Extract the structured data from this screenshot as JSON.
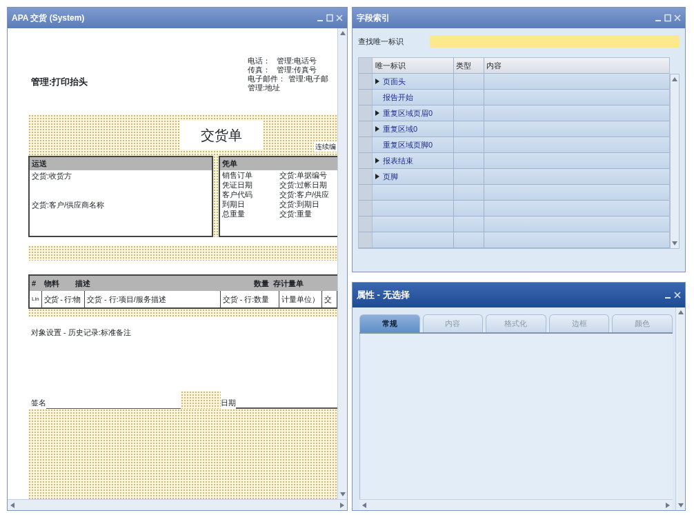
{
  "report_window": {
    "title": "APA 交货 (System)",
    "print_heading": "管理:打印抬头",
    "contacts": [
      {
        "label": "电话：",
        "value": "管理:电话号"
      },
      {
        "label": "传真：",
        "value": "管理:传真号"
      },
      {
        "label": "电子邮件：",
        "value": "管理:电子邮"
      }
    ],
    "address": "管理:地址",
    "document_title": "交货单",
    "doc_note": "连续编",
    "ship_box": {
      "heading": "运送",
      "lines": [
        "交货:收货方",
        "交货:客户/供应商名称"
      ]
    },
    "info_box": {
      "heading": "凭单",
      "rows": [
        {
          "label": "销售订单",
          "value": "交货:单据编号"
        },
        {
          "label": "凭证日期",
          "value": "交货:过帐日期"
        },
        {
          "label": "客户代码",
          "value": "交货:客户/供应"
        },
        {
          "label": "到期日",
          "value": "交货:到期日"
        },
        {
          "label": "总重量",
          "value": "交货:重量"
        }
      ]
    },
    "items_table": {
      "columns": [
        "#",
        "物料",
        "描述",
        "数量",
        "存计量单"
      ],
      "row": [
        "Lin",
        "交货 - 行:物",
        "交货 - 行:项目/服务描述",
        "交货 - 行:数量",
        "计量单位）",
        "交"
      ]
    },
    "remarks": "对象设置 - 历史记录:标准备注",
    "signature_label": "签名",
    "date_label": "日期"
  },
  "field_index": {
    "title": "字段索引",
    "search_label": "查找唯一标识",
    "columns": [
      "唯一标识",
      "类型",
      "内容"
    ],
    "rows": [
      {
        "label": "页面头",
        "expandable": true
      },
      {
        "label": "报告开始",
        "expandable": false
      },
      {
        "label": "重复区域页眉0",
        "expandable": true
      },
      {
        "label": "重复区域0",
        "expandable": true
      },
      {
        "label": "重复区域页脚0",
        "expandable": false
      },
      {
        "label": "报表结束",
        "expandable": true
      },
      {
        "label": "页脚",
        "expandable": true
      }
    ]
  },
  "properties": {
    "title": "属性 - 无选择",
    "tabs": [
      {
        "label": "常规",
        "selected": true
      },
      {
        "label": "内容",
        "selected": false
      },
      {
        "label": "格式化",
        "selected": false
      },
      {
        "label": "边框",
        "selected": false
      },
      {
        "label": "颜色",
        "selected": false
      }
    ]
  }
}
